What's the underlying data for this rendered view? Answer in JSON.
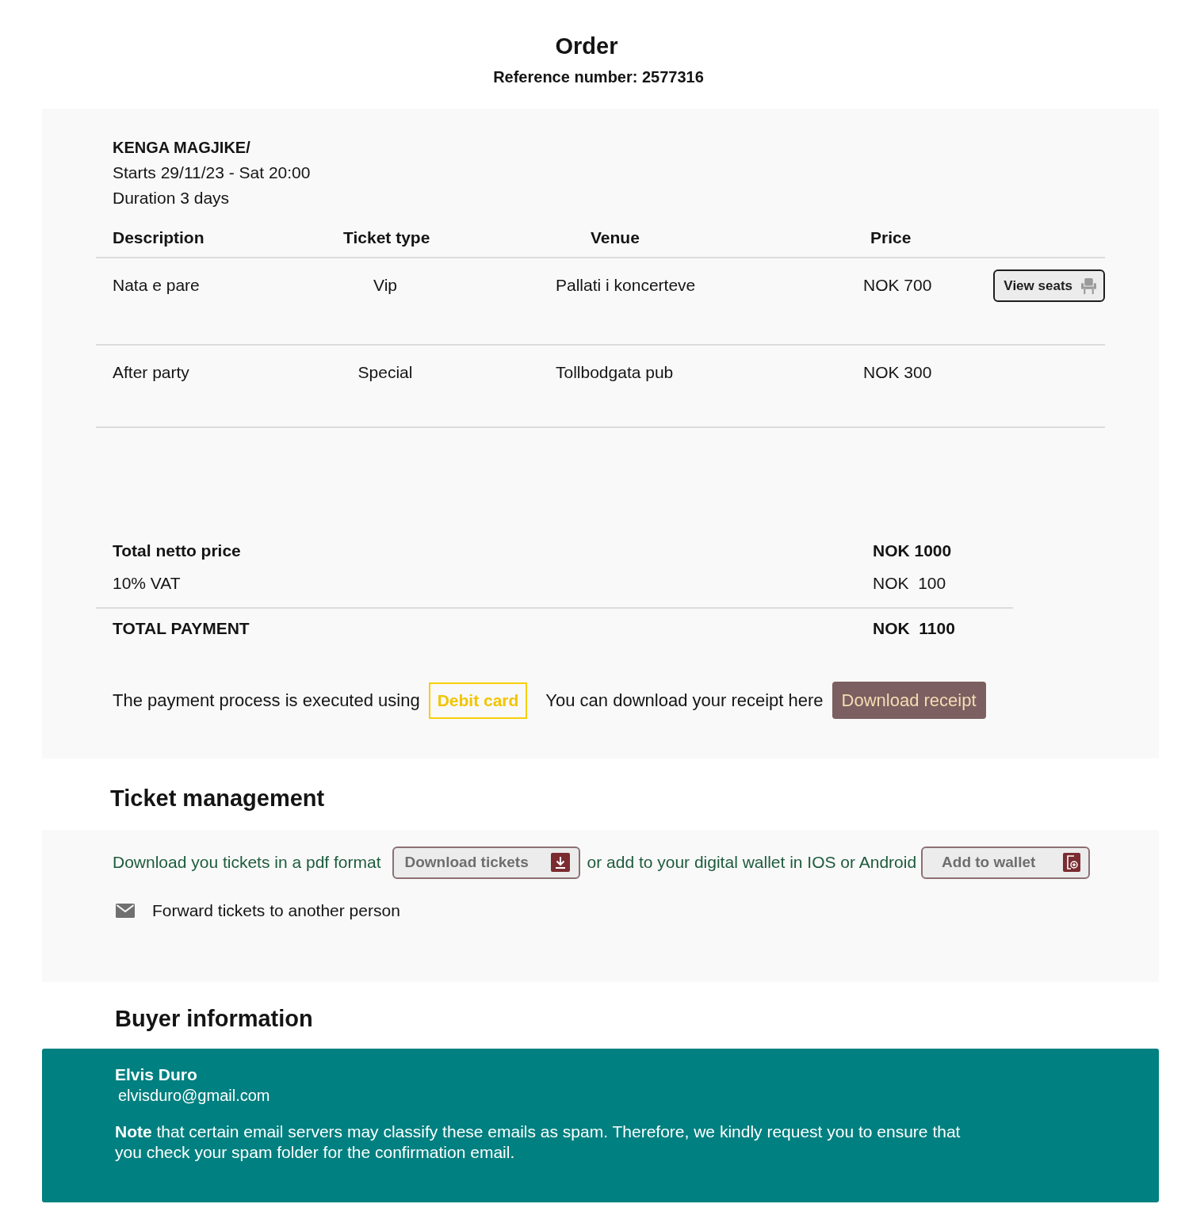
{
  "header": {
    "title": "Order",
    "reference": "Reference number: 2577316"
  },
  "order": {
    "event": {
      "title": "KENGA MAGJIKE/",
      "starts": "Starts 29/11/23 - Sat 20:00",
      "duration": "Duration 3 days"
    },
    "table": {
      "columns": [
        "Description",
        "Ticket type",
        "Venue",
        "Price"
      ],
      "rows": [
        {
          "cells": [
            "Nata e pare",
            "Vip",
            "Pallati i koncerteve",
            "NOK 700"
          ],
          "action": "View seats"
        },
        {
          "cells": [
            "After party",
            "Special",
            "Tollbodgata pub",
            "NOK 300"
          ]
        }
      ]
    },
    "totals": [
      {
        "kind": "subtotal",
        "label": "Total netto price",
        "value": "NOK 1000"
      },
      {
        "kind": "tax",
        "label": "10% VAT",
        "value": "NOK  100"
      },
      {
        "kind": "total",
        "label": "TOTAL PAYMENT",
        "value": "NOK  1100"
      }
    ],
    "payment": {
      "text": "The payment process is executed using",
      "method": "Debit card",
      "receipt_text": "You can download your receipt here",
      "receipt_button": "Download receipt"
    }
  },
  "ticket_management": {
    "heading": "Ticket management",
    "download_text": "Download you tickets in a pdf format",
    "download_button": "Download tickets",
    "wallet_text": "or add to your digital wallet in IOS or Android",
    "wallet_button": "Add to wallet",
    "forward": "Forward tickets to another person"
  },
  "buyer": {
    "heading": "Buyer information",
    "name": "Elvis Duro",
    "email": "elvisduro@gmail.com",
    "note": "**Note** that certain email servers may classify these emails as spam. Therefore, we kindly request you to ensure that you check your spam folder for the confirmation email."
  }
}
